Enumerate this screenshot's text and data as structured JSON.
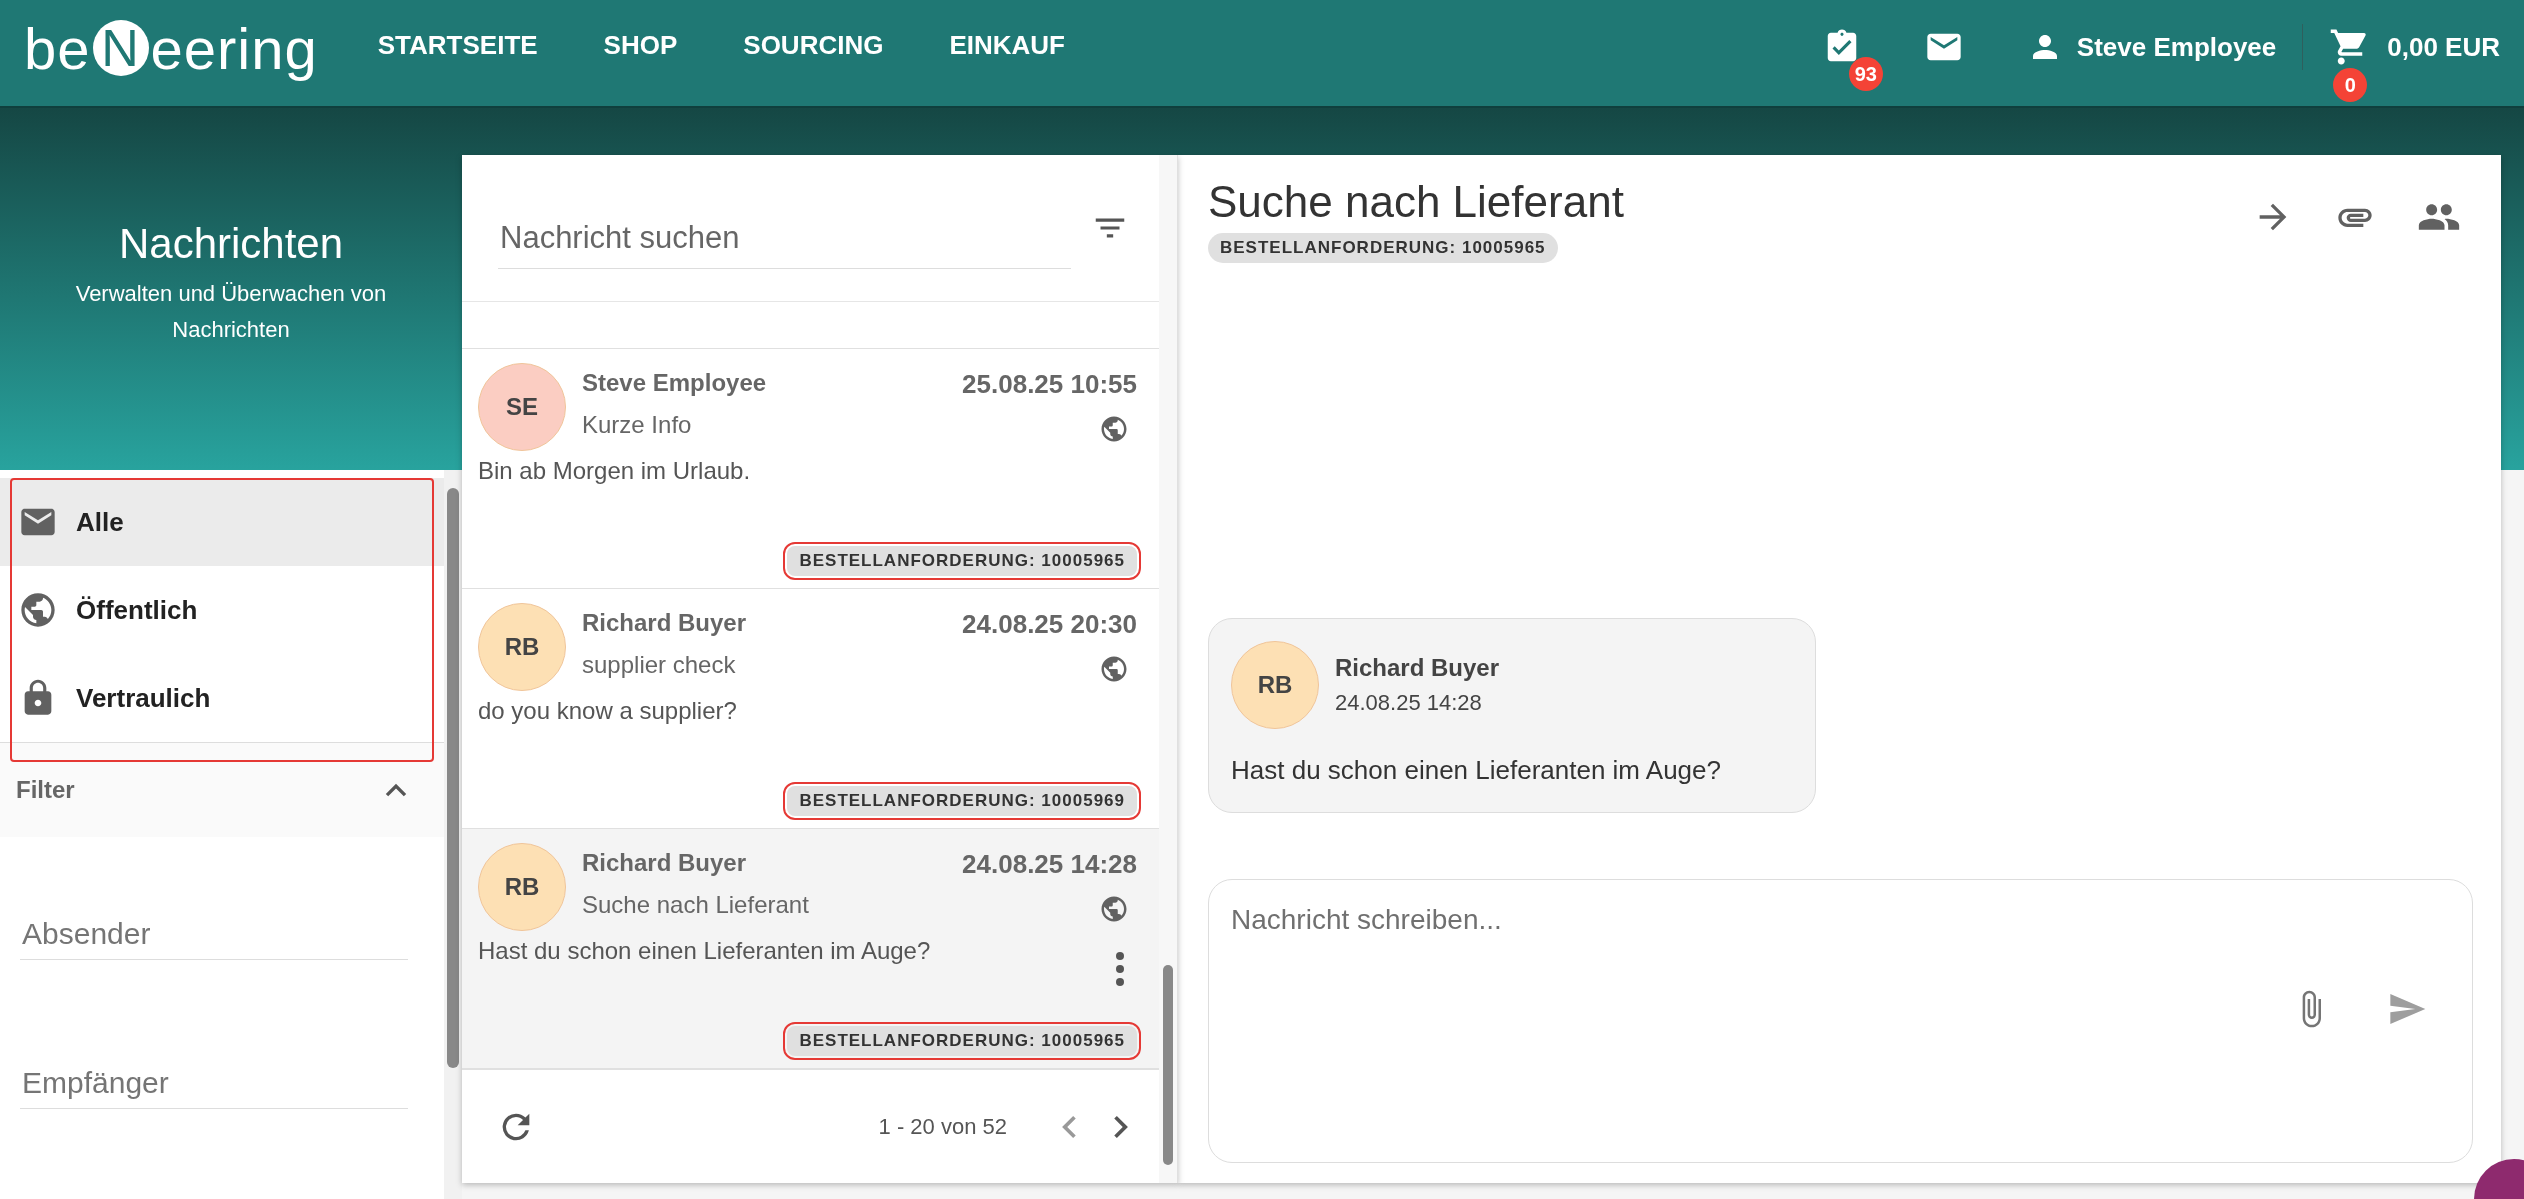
{
  "header": {
    "logo": {
      "before": "be",
      "mark": "N",
      "after": "eering"
    },
    "nav": [
      {
        "label": "STARTSEITE"
      },
      {
        "label": "SHOP"
      },
      {
        "label": "SOURCING"
      },
      {
        "label": "EINKAUF"
      }
    ],
    "tasks_badge": "93",
    "user_name": "Steve Employee",
    "cart_badge": "0",
    "cart_total": "0,00 EUR"
  },
  "sidebar": {
    "title": "Nachrichten",
    "subtitle": "Verwalten und Überwachen von Nachrichten",
    "folders_outlined": true,
    "folders": [
      {
        "kind": "all",
        "label": "Alle",
        "selected": true
      },
      {
        "kind": "public",
        "label": "Öffentlich",
        "selected": false
      },
      {
        "kind": "private",
        "label": "Vertraulich",
        "selected": false
      }
    ],
    "filter": {
      "label": "Filter",
      "expanded": true,
      "fields": [
        {
          "placeholder": "Absender"
        },
        {
          "placeholder": "Empfänger"
        }
      ]
    }
  },
  "message_list": {
    "search_placeholder": "Nachricht suchen",
    "items": [
      {
        "initials": "SE",
        "color": "#fbcdc2",
        "sender": "Steve Employee",
        "time": "25.08.25 10:55",
        "subject": "Kurze Info",
        "preview": "Bin ab Morgen im Urlaub.",
        "public": true,
        "tag": "BESTELLANFORDERUNG: 10005965",
        "tag_outlined": true,
        "selected": false
      },
      {
        "initials": "RB",
        "color": "#fde0b4",
        "sender": "Richard Buyer",
        "time": "24.08.25 20:30",
        "subject": "supplier check",
        "preview": "do you know a supplier?",
        "public": true,
        "tag": "BESTELLANFORDERUNG: 10005969",
        "tag_outlined": true,
        "selected": false
      },
      {
        "initials": "RB",
        "color": "#fde0b4",
        "sender": "Richard Buyer",
        "time": "24.08.25 14:28",
        "subject": "Suche nach Lieferant",
        "preview": "Hast du schon einen Lieferanten im Auge?",
        "public": true,
        "tag": "BESTELLANFORDERUNG: 10005965",
        "tag_outlined": true,
        "selected": true
      }
    ],
    "pagination": "1 - 20 von 52"
  },
  "thread": {
    "title": "Suche nach Lieferant",
    "tag": "BESTELLANFORDERUNG: 10005965",
    "messages": [
      {
        "initials": "RB",
        "color": "#fde0b4",
        "sender": "Richard Buyer",
        "time": "24.08.25 14:28",
        "text": "Hast du schon einen Lieferanten im Auge?"
      }
    ],
    "composer_placeholder": "Nachricht schreiben..."
  }
}
